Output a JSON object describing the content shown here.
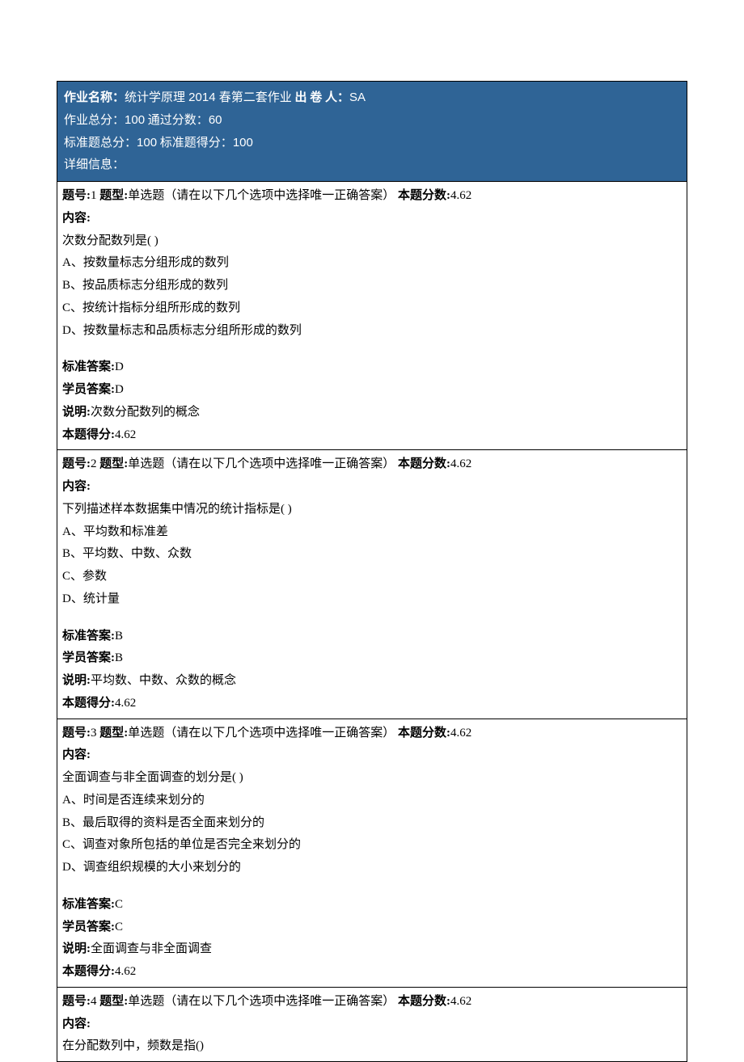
{
  "header": {
    "hwNameLabel": "作业名称：",
    "hwName": "统计学原理 2014 春第二套作业",
    "authorLabel": " 出 卷 人：",
    "author": "SA",
    "totalLabel": "作业总分：",
    "total": "100",
    "passLabel": " 通过分数：",
    "pass": "60",
    "stdTotalLabel": "标准题总分：",
    "stdTotal": "100",
    "stdScoreLabel": " 标准题得分：",
    "stdScore": "100",
    "detailLabel": "详细信息："
  },
  "labels": {
    "qnum": "题号:",
    "qtype": " 题型:",
    "qtypeVal": "单选题（请在以下几个选项中选择唯一正确答案）",
    "qscoreLabel": " 本题分数:",
    "content": "内容:",
    "stdAnswer": "标准答案:",
    "stuAnswer": "学员答案:",
    "explain": "说明:",
    "got": "本题得分:"
  },
  "questions": [
    {
      "num": "1",
      "score": "4.62",
      "prompt": "次数分配数列是( )",
      "options": [
        "A、按数量标志分组形成的数列",
        "B、按品质标志分组形成的数列",
        "C、按统计指标分组所形成的数列",
        "D、按数量标志和品质标志分组所形成的数列"
      ],
      "stdAnswer": "D",
      "stuAnswer": "D",
      "explain": "次数分配数列的概念",
      "got": "4.62"
    },
    {
      "num": "2",
      "score": "4.62",
      "prompt": "下列描述样本数据集中情况的统计指标是( )",
      "options": [
        "A、平均数和标准差",
        "B、平均数、中数、众数",
        "C、参数",
        "D、统计量"
      ],
      "stdAnswer": "B",
      "stuAnswer": "B",
      "explain": "平均数、中数、众数的概念",
      "got": "4.62"
    },
    {
      "num": "3",
      "score": "4.62",
      "prompt": "全面调查与非全面调查的划分是( )",
      "options": [
        "A、时间是否连续来划分的",
        "B、最后取得的资料是否全面来划分的",
        "C、调查对象所包括的单位是否完全来划分的",
        "D、调查组织规模的大小来划分的"
      ],
      "stdAnswer": "C",
      "stuAnswer": "C",
      "explain": "全面调查与非全面调查",
      "got": "4.62"
    },
    {
      "num": "4",
      "score": "4.62",
      "prompt": "在分配数列中，频数是指()",
      "options": [],
      "stdAnswer": "",
      "stuAnswer": "",
      "explain": "",
      "got": ""
    }
  ]
}
